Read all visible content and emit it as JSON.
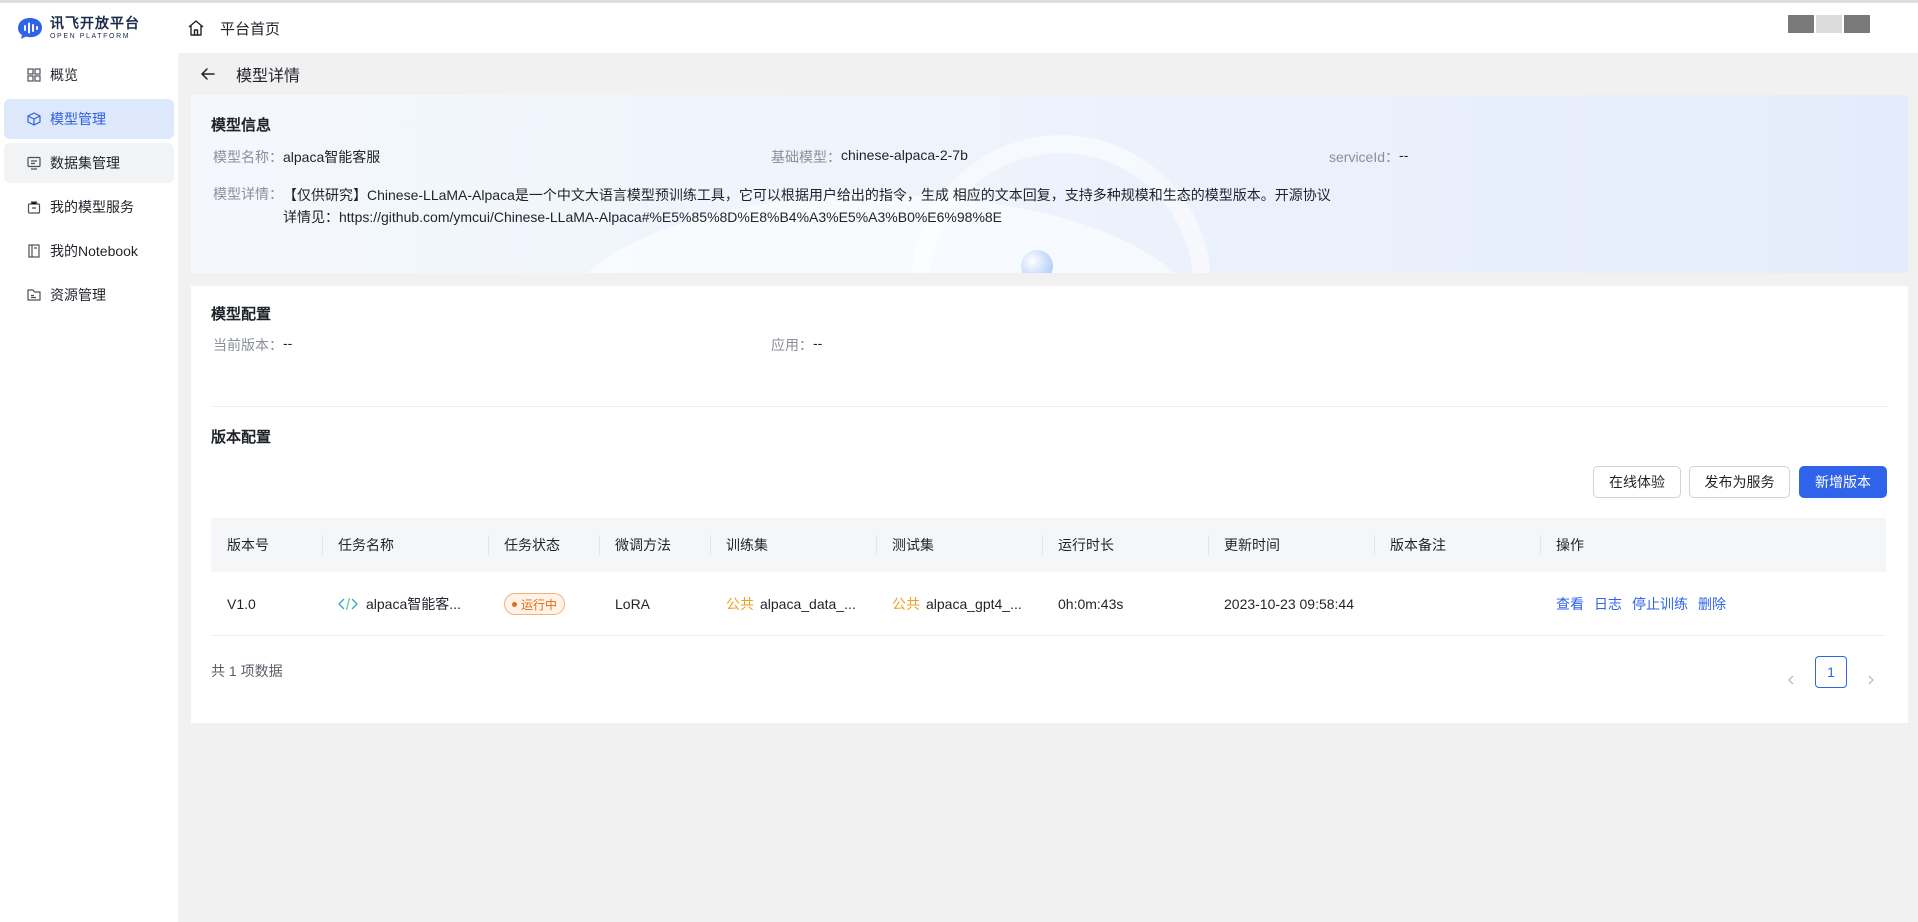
{
  "header": {
    "logo_cn": "讯飞开放平台",
    "logo_en": "OPEN PLATFORM",
    "home_label": "平台首页"
  },
  "sidebar": {
    "items": [
      {
        "label": "概览",
        "icon": "dashboard-icon"
      },
      {
        "label": "模型管理",
        "icon": "cube-icon"
      },
      {
        "label": "数据集管理",
        "icon": "monitor-icon"
      },
      {
        "label": "我的模型服务",
        "icon": "bag-icon"
      },
      {
        "label": "我的Notebook",
        "icon": "notebook-icon"
      },
      {
        "label": "资源管理",
        "icon": "folder-icon"
      }
    ]
  },
  "page": {
    "title": "模型详情"
  },
  "model_info": {
    "title": "模型信息",
    "name_label": "模型名称：",
    "name_value": "alpaca智能客服",
    "base_label": "基础模型：",
    "base_value": "chinese-alpaca-2-7b",
    "service_label": "serviceId：",
    "service_value": "--",
    "desc_label": "模型详情：",
    "desc_value": "【仅供研究】Chinese-LLaMA-Alpaca是一个中文大语言模型预训练工具，它可以根据用户给出的指令，生成 相应的文本回复，支持多种规模和生态的模型版本。开源协议详情见：https://github.com/ymcui/Chinese-LLaMA-Alpaca#%E5%85%8D%E8%B4%A3%E5%A3%B0%E6%98%8E"
  },
  "model_config": {
    "title": "模型配置",
    "version_label": "当前版本：",
    "version_value": "--",
    "app_label": "应用：",
    "app_value": "--"
  },
  "version_config": {
    "title": "版本配置",
    "buttons": {
      "try_online": "在线体验",
      "publish": "发布为服务",
      "add_version": "新增版本"
    },
    "columns": [
      "版本号",
      "任务名称",
      "任务状态",
      "微调方法",
      "训练集",
      "测试集",
      "运行时长",
      "更新时间",
      "版本备注",
      "操作"
    ],
    "rows": [
      {
        "version": "V1.0",
        "task_name": "alpaca智能客...",
        "status": "运行中",
        "method": "LoRA",
        "train_tag": "公共",
        "train_set": "alpaca_data_...",
        "test_tag": "公共",
        "test_set": "alpaca_gpt4_...",
        "duration": "0h:0m:43s",
        "updated": "2023-10-23 09:58:44",
        "note": "",
        "actions": [
          "查看",
          "日志",
          "停止训练",
          "删除"
        ]
      }
    ],
    "total_text": "共 1 项数据",
    "current_page": "1"
  },
  "colors": {
    "primary": "#2f63ea",
    "status_running": "#e46b14",
    "public_tag": "#f0a020"
  }
}
